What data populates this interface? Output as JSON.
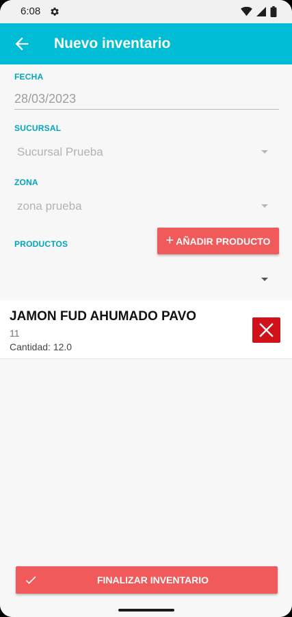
{
  "status_bar": {
    "time": "6:08"
  },
  "app_bar": {
    "title": "Nuevo inventario"
  },
  "form": {
    "date_label": "FECHA",
    "date_value": "28/03/2023",
    "branch_label": "SUCURSAL",
    "branch_value": "Sucursal Prueba",
    "zone_label": "ZONA",
    "zone_value": "zona prueba",
    "products_label": "PRODUCTOS",
    "add_product_label": "AÑADIR PRODUCTO",
    "product_select_value": ""
  },
  "products": [
    {
      "name": "JAMON FUD AHUMADO PAVO",
      "code": "11",
      "quantity": "Cantidad: 12.0"
    }
  ],
  "footer": {
    "finish_label": "FINALIZAR INVENTARIO"
  },
  "colors": {
    "app_bar": "#00bcd4",
    "accent_label": "#00a5c0",
    "primary_button": "#f15a5a",
    "delete_button": "#d0111a"
  },
  "icons": [
    "settings-icon",
    "wifi-icon",
    "signal-icon",
    "battery-icon",
    "back-arrow-icon",
    "plus-icon",
    "close-icon",
    "check-icon"
  ]
}
